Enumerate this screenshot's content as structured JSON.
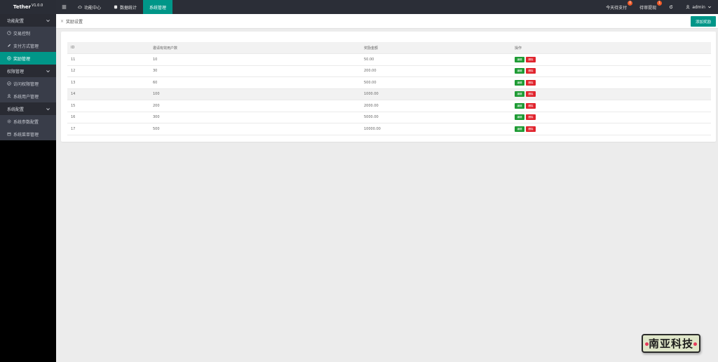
{
  "app": {
    "name": "Tether",
    "version": "V1.0.0"
  },
  "topnav": {
    "items": [
      {
        "label": "功能中心",
        "icon": "cloud-icon"
      },
      {
        "label": "数据统计",
        "icon": "database-icon"
      },
      {
        "label": "系统管理",
        "icon": "",
        "active": true
      }
    ],
    "right": {
      "today_pay": {
        "label": "今天待支付",
        "badge": "0"
      },
      "pending": {
        "label": "待审提现",
        "badge": "1"
      },
      "user": "admin"
    }
  },
  "sidebar": {
    "groups": [
      {
        "label": "功能配置",
        "items": [
          {
            "label": "交易控制",
            "icon": "dashboard-icon"
          },
          {
            "label": "支付方式管理",
            "icon": "edit-icon"
          },
          {
            "label": "奖励管理",
            "icon": "settings-icon",
            "active": true
          }
        ]
      },
      {
        "label": "权限管理",
        "items": [
          {
            "label": "访问权限管理",
            "icon": "check-circle-icon"
          },
          {
            "label": "系统用户管理",
            "icon": "user-icon"
          }
        ]
      },
      {
        "label": "系统配置",
        "items": [
          {
            "label": "系统参数配置",
            "icon": "gear-icon"
          },
          {
            "label": "系统菜单管理",
            "icon": "calendar-icon"
          }
        ]
      }
    ]
  },
  "tabs": {
    "current": "奖励设置",
    "add_button": "添加奖励"
  },
  "table": {
    "headers": [
      "ID",
      "邀请有效用户数",
      "奖励金额",
      "操作"
    ],
    "edit_label": "编辑",
    "delete_label": "删除",
    "rows": [
      [
        "11",
        "10",
        "50.00"
      ],
      [
        "12",
        "30",
        "200.00"
      ],
      [
        "13",
        "60",
        "500.00"
      ],
      [
        "14",
        "100",
        "1000.00"
      ],
      [
        "15",
        "200",
        "2000.00"
      ],
      [
        "16",
        "300",
        "5000.00"
      ],
      [
        "17",
        "500",
        "10000.00"
      ]
    ]
  },
  "watermark": {
    "text": "南亚科技"
  },
  "colors": {
    "accent": "#009688",
    "topbar": "#2b2e37",
    "edit": "#1e9b34",
    "delete": "#e0242d"
  }
}
